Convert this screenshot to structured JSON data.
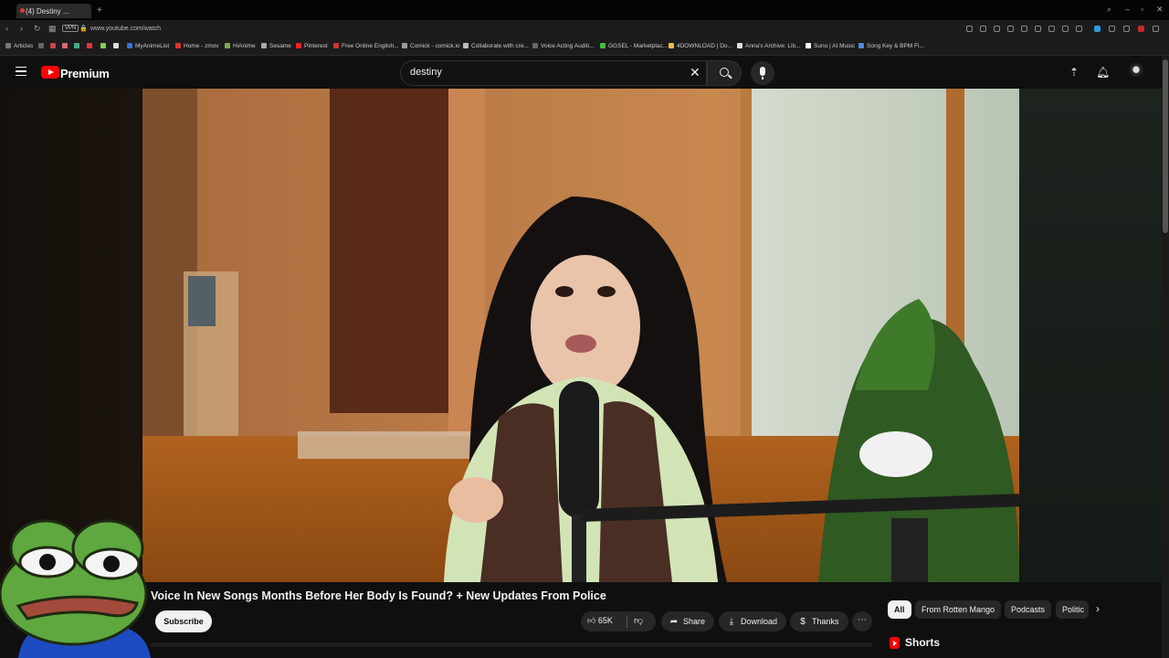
{
  "browser": {
    "tab_title": "(4) Destiny ...",
    "url": "www.youtube.com/watch",
    "vpn_label": "VPN",
    "bookmarks": [
      "Articles",
      "MyAnimeList",
      "Home - zmov",
      "HiAnime",
      "Sesame",
      "Pinterest",
      "Free Online English...",
      "Comick - comick.io",
      "Collaborate with cre...",
      "Voice Acting Auditi...",
      "GGSEL - Marketplac...",
      "4DOWNLOAD | Do...",
      "Anna's Archive: Lib...",
      "Suno | AI Music",
      "Song Key & BPM Fi..."
    ]
  },
  "header": {
    "brand": "Premium",
    "search_value": "destiny"
  },
  "video": {
    "title": "Voice In New Songs Months Before Her Body Is Found? + New Updates From Police"
  },
  "actions": {
    "subscribe": "Subscribe",
    "likes": "65K",
    "share": "Share",
    "download": "Download",
    "thanks": "Thanks",
    "more": "⋯"
  },
  "chips": [
    "All",
    "From Rotten Mango",
    "Podcasts",
    "Politic"
  ],
  "shorts": {
    "title": "Shorts"
  },
  "colors": {
    "brand_red": "#ff0000",
    "background": "#0f0f0f",
    "chip_bg": "#272727"
  }
}
